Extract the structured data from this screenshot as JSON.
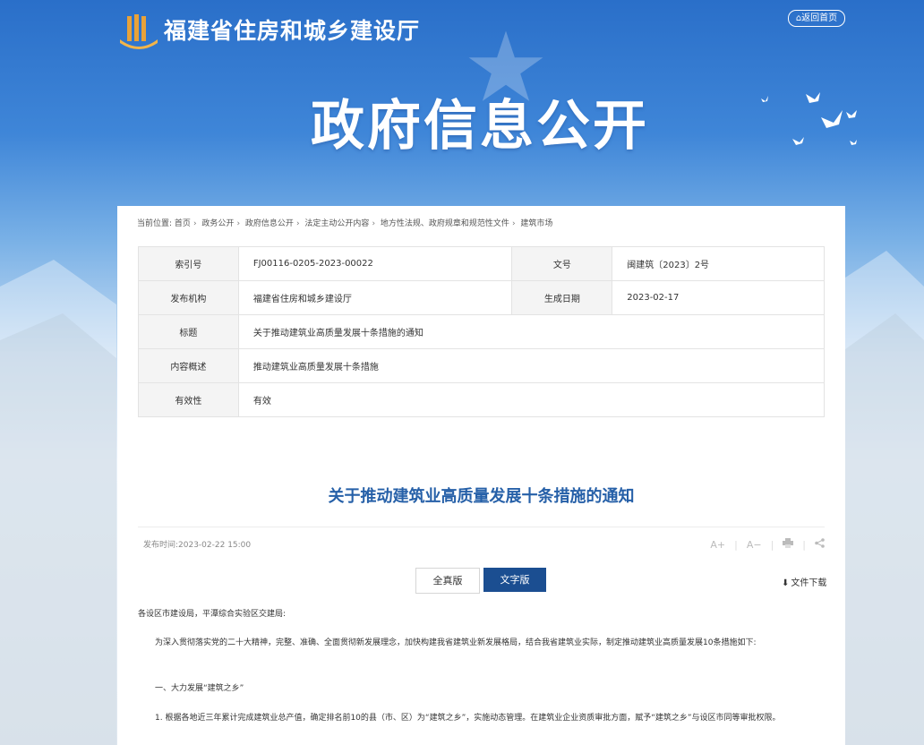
{
  "header": {
    "site_title": "福建省住房和城乡建设厅",
    "home_button": "返回首页",
    "banner_title": "政府信息公开"
  },
  "breadcrumb": {
    "prefix": "当前位置:",
    "items": [
      "首页",
      "政务公开",
      "政府信息公开",
      "法定主动公开内容",
      "地方性法规、政府规章和规范性文件",
      "建筑市场"
    ]
  },
  "info_table": {
    "index_label": "索引号",
    "index_value": "FJ00116-0205-2023-00022",
    "docno_label": "文号",
    "docno_value": "闽建筑〔2023〕2号",
    "org_label": "发布机构",
    "org_value": "福建省住房和城乡建设厅",
    "date_label": "生成日期",
    "date_value": "2023-02-17",
    "title_label": "标题",
    "title_value": "关于推动建筑业高质量发展十条措施的通知",
    "summary_label": "内容概述",
    "summary_value": "推动建筑业高质量发展十条措施",
    "validity_label": "有效性",
    "validity_value": "有效"
  },
  "article": {
    "title": "关于推动建筑业高质量发展十条措施的通知",
    "publish_time": "发布时间:2023-02-22 15:00",
    "tools": [
      "A+",
      "A−",
      "print-icon",
      "share-icon"
    ],
    "btn_full": "全真版",
    "btn_text": "文字版",
    "download": "文件下载",
    "paragraphs": [
      "各设区市建设局，平潭综合实验区交建局:",
      "为深入贯彻落实党的二十大精神，完整、准确、全面贯彻新发展理念，加快构建我省建筑业新发展格局，结合我省建筑业实际，制定推动建筑业高质量发展10条措施如下:",
      "一、大力发展“建筑之乡”",
      "1. 根据各地近三年累计完成建筑业总产值，确定排名前10的县（市、区）为“建筑之乡”，实施动态管理。在建筑业企业资质审批方面，赋予“建筑之乡”与设区市同等审批权限。"
    ]
  },
  "colors": {
    "accent": "#1b4e91",
    "title_blue": "#2660a8"
  }
}
